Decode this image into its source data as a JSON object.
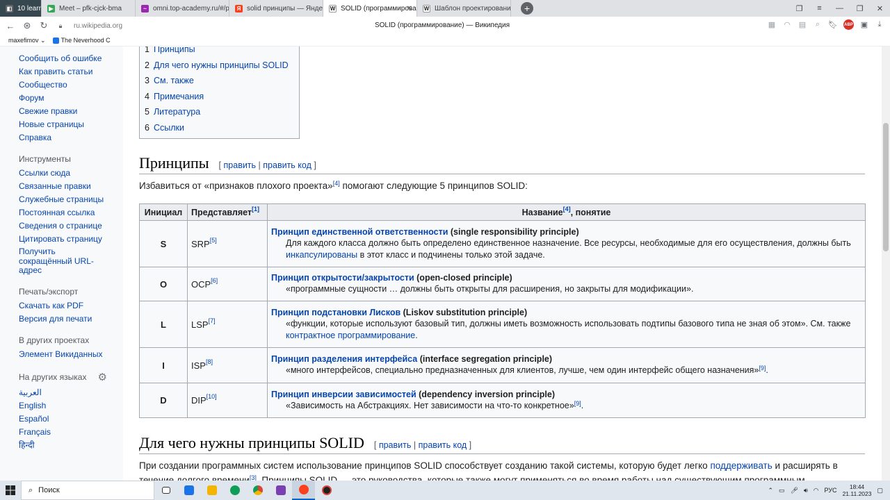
{
  "browser": {
    "tabs": [
      {
        "label": "10 learn",
        "favicon_color": "#37474f"
      },
      {
        "label": "Meet – pfk-cjck-bma",
        "favicon_color": "#34a853"
      },
      {
        "label": "omni.top-academy.ru/#/p",
        "favicon_color": "#9c27b0"
      },
      {
        "label": "solid принципы — Яндекс",
        "favicon_color": "#fc3f1d"
      },
      {
        "label": "SOLID (программирован",
        "favicon_color": "#202122"
      },
      {
        "label": "Шаблон проектирования",
        "favicon_color": "#202122"
      }
    ],
    "new_tab": "+",
    "url": "ru.wikipedia.org",
    "page_title": "SOLID (программирование) — Википедия",
    "abp": "ABP",
    "bookmarks": [
      "maxefimov",
      "The Neverhood C"
    ]
  },
  "sidebar": {
    "nav_items": [
      "Сообщить об ошибке",
      "Как править статьи",
      "Сообщество",
      "Форум",
      "Свежие правки",
      "Новые страницы",
      "Справка"
    ],
    "tools_heading": "Инструменты",
    "tools_items": [
      "Ссылки сюда",
      "Связанные правки",
      "Служебные страницы",
      "Постоянная ссылка",
      "Сведения о странице",
      "Цитировать страницу",
      "Получить сокращённый URL-адрес"
    ],
    "print_heading": "Печать/экспорт",
    "print_items": [
      "Скачать как PDF",
      "Версия для печати"
    ],
    "projects_heading": "В других проектах",
    "projects_items": [
      "Элемент Викиданных"
    ],
    "languages_heading": "На других языках",
    "languages": [
      "العربية",
      "English",
      "Español",
      "Français",
      "हिन्दी"
    ]
  },
  "toc": [
    {
      "num": "1",
      "label": "Принципы"
    },
    {
      "num": "2",
      "label": "Для чего нужны принципы SOLID"
    },
    {
      "num": "3",
      "label": "См. также"
    },
    {
      "num": "4",
      "label": "Примечания"
    },
    {
      "num": "5",
      "label": "Литература"
    },
    {
      "num": "6",
      "label": "Ссылки"
    }
  ],
  "section1": {
    "title": "Принципы",
    "edit_open": "[",
    "edit": "править",
    "sep": "|",
    "edit_code": "править код",
    "edit_close": "]",
    "intro_a": "Избавиться от «признаков плохого проекта»",
    "intro_ref": "[4]",
    "intro_b": " помогают следующие 5 принципов SOLID:"
  },
  "table": {
    "headers": {
      "initial": "Инициал",
      "represents": "Представляет",
      "represents_ref": "[1]",
      "name": "Название",
      "name_ref": "[4]",
      "name_tail": ", понятие"
    },
    "rows": [
      {
        "initial": "S",
        "abbr": "SRP",
        "ref": "[5]",
        "link": "Принцип единственной ответственности",
        "en": " (single responsibility principle)",
        "desc_a": "Для каждого класса должно быть определено единственное назначение. Все ресурсы, необходимые для его осуществления, должны быть ",
        "desc_link": "инкапсулированы",
        "desc_b": " в этот класс и подчинены только этой задаче.",
        "desc_ref": ""
      },
      {
        "initial": "O",
        "abbr": "OCP",
        "ref": "[6]",
        "link": "Принцип открытости/закрытости",
        "en": " (open-closed principle)",
        "desc_a": "«программные сущности … должны быть открыты для расширения, но закрыты для модификации».",
        "desc_link": "",
        "desc_b": "",
        "desc_ref": ""
      },
      {
        "initial": "L",
        "abbr": "LSP",
        "ref": "[7]",
        "link": "Принцип подстановки Лисков",
        "en": " (Liskov substitution principle)",
        "desc_a": "«функции, которые используют базовый тип, должны иметь возможность использовать подтипы базового типа не зная об этом». См. также ",
        "desc_link": "контрактное программирование",
        "desc_b": ".",
        "desc_ref": ""
      },
      {
        "initial": "I",
        "abbr": "ISP",
        "ref": "[8]",
        "link": "Принцип разделения интерфейса",
        "en": " (interface segregation principle)",
        "desc_a": "«много интерфейсов, специально предназначенных для клиентов, лучше, чем один интерфейс общего назначения»",
        "desc_link": "",
        "desc_b": ".",
        "desc_ref": "[9]"
      },
      {
        "initial": "D",
        "abbr": "DIP",
        "ref": "[10]",
        "link": "Принцип инверсии зависимостей",
        "en": " (dependency inversion principle)",
        "desc_a": "«Зависимость на Абстракциях. Нет зависимости на что-то конкретное»",
        "desc_link": "",
        "desc_b": ".",
        "desc_ref": "[9]"
      }
    ]
  },
  "section2": {
    "title": "Для чего нужны принципы SOLID",
    "para_a": "При создании программных систем использование принципов SOLID способствует созданию такой системы, которую будет легко ",
    "para_link": "поддерживать",
    "para_b": " и расширять в течение долгого времени",
    "para_ref": "[3]",
    "para_c": ". Принципы SOLID — это руководства, которые также могут применяться во время работы над существующим программным"
  },
  "taskbar": {
    "search": "Поиск",
    "lang": "РУС",
    "time": "18:44",
    "date": "21.11.2023"
  }
}
